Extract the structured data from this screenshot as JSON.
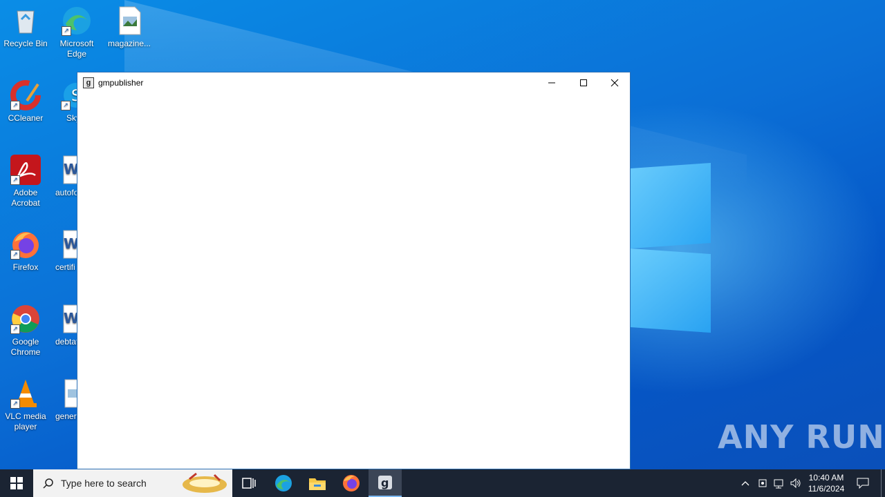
{
  "desktop": {
    "icons": [
      {
        "label": "Recycle Bin",
        "icon": "recycle-bin-icon"
      },
      {
        "label": "Microsoft Edge",
        "icon": "edge-icon"
      },
      {
        "label": "magazine...",
        "icon": "image-file-icon"
      },
      {
        "label": "CCleaner",
        "icon": "ccleaner-icon"
      },
      {
        "label": "Sky",
        "icon": "skype-icon"
      },
      {
        "label": "Adobe Acrobat",
        "icon": "acrobat-icon"
      },
      {
        "label": "autofo",
        "icon": "word-doc-icon"
      },
      {
        "label": "Firefox",
        "icon": "firefox-icon"
      },
      {
        "label": "certifi",
        "icon": "word-doc-icon"
      },
      {
        "label": "Google Chrome",
        "icon": "chrome-icon"
      },
      {
        "label": "debtat",
        "icon": "word-doc-icon"
      },
      {
        "label": "VLC media player",
        "icon": "vlc-icon"
      },
      {
        "label": "genera",
        "icon": "image-file-icon"
      }
    ]
  },
  "window": {
    "title": "gmpublisher",
    "buttons": {
      "minimize": "minimize-icon",
      "maximize": "maximize-icon",
      "close": "close-icon"
    }
  },
  "taskbar": {
    "search_placeholder": "Type here to search",
    "apps": [
      "task-view-icon",
      "edge-icon",
      "file-explorer-icon",
      "firefox-icon",
      "gmpublisher-icon"
    ],
    "clock_time": "10:40 AM",
    "clock_date": "11/6/2024"
  },
  "watermark": "ANY RUN",
  "colors": {
    "desktop": "#0b6fd6",
    "taskbar": "#1b2433",
    "window_border": "#2b6fb5"
  }
}
